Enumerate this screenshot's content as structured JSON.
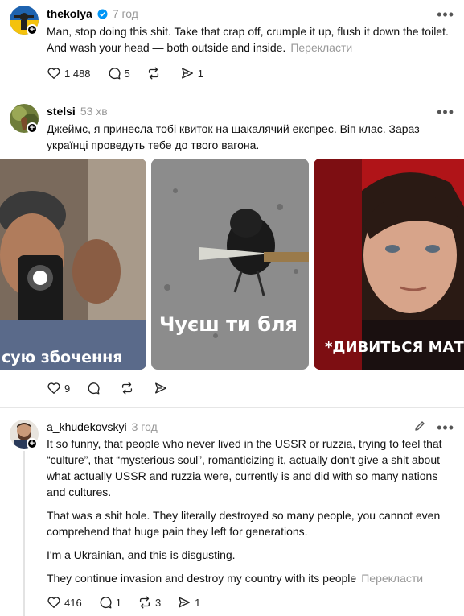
{
  "posts": [
    {
      "username": "thekolya",
      "time": "7 год",
      "verified": true,
      "text": "Man, stop doing this shit. Take that crap off, crumple it up, flush it down the toilet. And wash your head — both outside and inside.",
      "translate": "Перекласти",
      "likes": "1 488",
      "replies": "5",
      "reposts": "",
      "shares": "1"
    },
    {
      "username": "stelsi",
      "time": "53 хв",
      "text": "Джеймс, я принесла тобі квиток на шакалячий експрес. Віп клас. Зараз українці проведуть тебе до твого вагона.",
      "media_captions": [
        "сую збочення",
        "Чуєш ти бля",
        "*ДИВИТЬСЯ МАТ"
      ],
      "likes": "9",
      "replies": "",
      "reposts": "",
      "shares": ""
    },
    {
      "username": "a_khudekovskyi",
      "time": "3 год",
      "paragraphs": [
        "It so funny, that people who never lived in the USSR or ruzzia, trying to feel that “culture”, that “mysterious soul”, romanticizing it, actually don't give a shit about what actually USSR and ruzzia were, currently is and did with so many nations and cultures.",
        "That was a shit hole. They literally destroyed so many people, you cannot even comprehend that huge pain they left for generations.",
        "I'm a Ukrainian, and this is disgusting.",
        "They continue invasion and destroy my country with its people"
      ],
      "translate": "Перекласти",
      "likes": "416",
      "replies": "1",
      "reposts": "3",
      "shares": "1"
    }
  ],
  "icons": {
    "like": "heart-icon",
    "reply": "comment-icon",
    "repost": "repost-icon",
    "share": "share-icon",
    "more": "more-icon",
    "edit": "pencil-icon"
  },
  "colors": {
    "verified": "#0095f6",
    "muted": "#999999"
  }
}
